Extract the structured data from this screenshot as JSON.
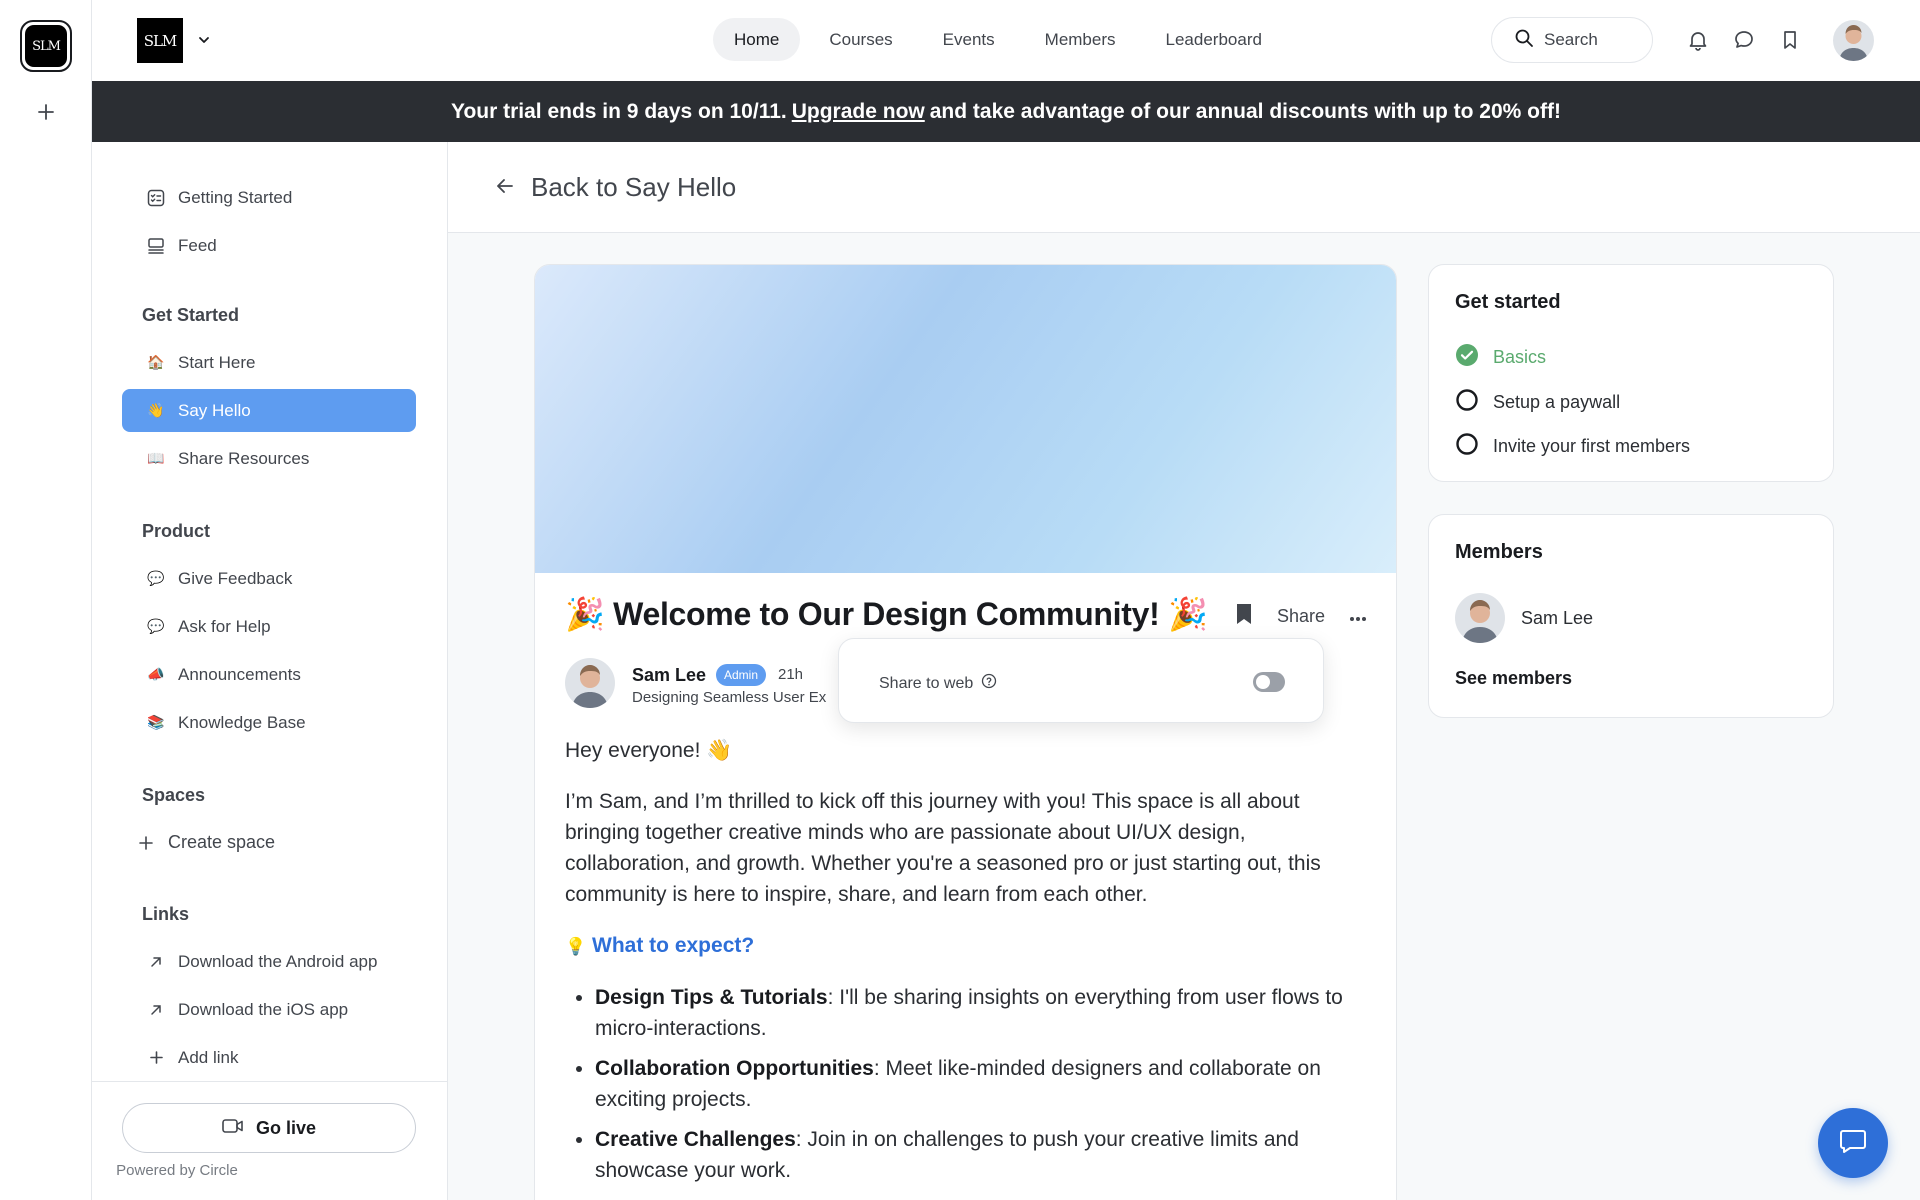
{
  "rail": {
    "logo_text": "SLM"
  },
  "header": {
    "brand_text": "SLM",
    "nav": [
      "Home",
      "Courses",
      "Events",
      "Members",
      "Leaderboard"
    ],
    "search_label": "Search"
  },
  "banner": {
    "before": "Your trial ends in 9 days on 10/11.",
    "link": "Upgrade now",
    "after": "and take advantage of our annual discounts with up to 20% off!"
  },
  "sidebar": {
    "top_items": [
      {
        "label": "Getting Started",
        "icon": "checklist-icon"
      },
      {
        "label": "Feed",
        "icon": "feed-icon"
      }
    ],
    "sections": [
      {
        "heading": "Get Started",
        "items": [
          {
            "label": "Start Here",
            "emoji": "🏠"
          },
          {
            "label": "Say Hello",
            "emoji": "👋"
          },
          {
            "label": "Share Resources",
            "emoji": "📖"
          }
        ]
      },
      {
        "heading": "Product",
        "items": [
          {
            "label": "Give Feedback",
            "emoji": "💬"
          },
          {
            "label": "Ask for Help",
            "emoji": "💬"
          },
          {
            "label": "Announcements",
            "emoji": "📣"
          },
          {
            "label": "Knowledge Base",
            "emoji": "📚"
          }
        ]
      },
      {
        "heading": "Spaces",
        "items": [
          {
            "label": "Create space",
            "icon": "plus-icon"
          }
        ]
      },
      {
        "heading": "Links",
        "items": [
          {
            "label": "Download the Android app",
            "icon": "arrow-up-right-icon"
          },
          {
            "label": "Download the iOS app",
            "icon": "arrow-up-right-icon"
          },
          {
            "label": "Add link",
            "icon": "plus-icon"
          }
        ]
      }
    ],
    "go_live": "Go live",
    "powered_by": "Powered by Circle"
  },
  "back": {
    "label": "Back to Say Hello"
  },
  "post": {
    "title": "🎉 Welcome to Our Design Community! 🎉",
    "share_label": "Share",
    "author": "Sam Lee",
    "badge": "Admin",
    "time": "21h",
    "bio": "Designing Seamless User Ex",
    "greeting": "Hey everyone! 👋",
    "intro": "I’m Sam, and I’m thrilled to kick off this journey with you! This space is all about bringing together creative minds who are passionate about UI/UX design, collaboration, and growth. Whether you're a seasoned pro or just starting out, this community is here to inspire, share, and learn from each other.",
    "expect_emoji": "💡",
    "expect_heading": "What to expect?",
    "bullets": [
      {
        "bold": "Design Tips & Tutorials",
        "text": ": I'll be sharing insights on everything from user flows to micro-interactions."
      },
      {
        "bold": "Collaboration Opportunities",
        "text": ": Meet like-minded designers and collaborate on exciting projects."
      },
      {
        "bold": "Creative Challenges",
        "text": ": Join in on challenges to push your creative limits and showcase your work."
      }
    ]
  },
  "popover": {
    "label": "Share to web",
    "toggle_on": false
  },
  "get_started": {
    "title": "Get started",
    "items": [
      {
        "label": "Basics",
        "done": true
      },
      {
        "label": "Setup a paywall",
        "done": false
      },
      {
        "label": "Invite your first members",
        "done": false
      }
    ]
  },
  "members": {
    "title": "Members",
    "member_name": "Sam Lee",
    "see_all": "See members"
  },
  "colors": {
    "accent": "#5e9cf0",
    "link": "#2e6fd8",
    "done": "#5aaa6e",
    "banner_bg": "#2b2e33"
  }
}
